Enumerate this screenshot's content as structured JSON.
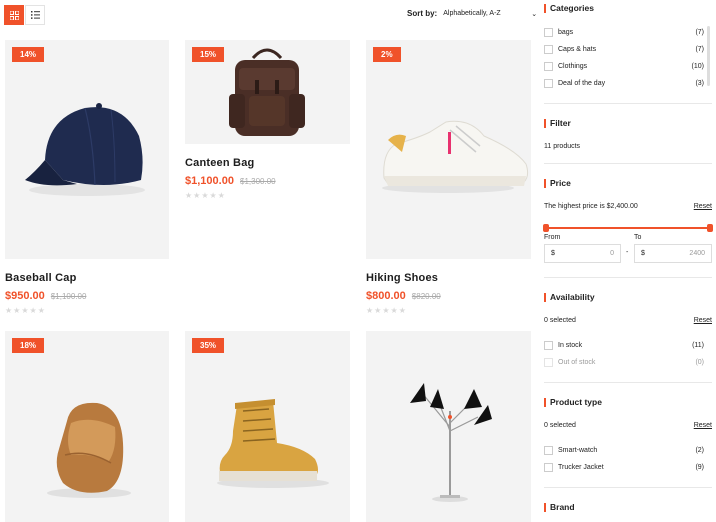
{
  "toolbar": {
    "grid_icon": "grid-icon",
    "list_icon": "list-icon",
    "sort_label": "Sort by:",
    "sort_value": "Alphabetically, A-Z"
  },
  "products": [
    {
      "name": "Baseball Cap",
      "badge": "14%",
      "price": "$950.00",
      "old_price": "$1,100.00",
      "stars": "★★★★★"
    },
    {
      "name": "Canteen Bag",
      "badge": "15%",
      "price": "$1,100.00",
      "old_price": "$1,300.00",
      "stars": "★★★★★"
    },
    {
      "name": "Hiking Shoes",
      "badge": "2%",
      "price": "$800.00",
      "old_price": "$820.00",
      "stars": "★★★★★"
    },
    {
      "name": "",
      "badge": "18%"
    },
    {
      "name": "",
      "badge": "35%"
    },
    {
      "name": "",
      "badge": ""
    }
  ],
  "sidebar": {
    "categories": {
      "title": "Categories",
      "items": [
        {
          "label": "bags",
          "count": "(7)"
        },
        {
          "label": "Caps & hats",
          "count": "(7)"
        },
        {
          "label": "Clothings",
          "count": "(10)"
        },
        {
          "label": "Deal of the day",
          "count": "(3)"
        }
      ]
    },
    "filter": {
      "title": "Filter",
      "summary": "11 products"
    },
    "price": {
      "title": "Price",
      "highest": "The highest price is $2,400.00",
      "reset": "Reset",
      "from_label": "From",
      "to_label": "To",
      "currency": "$",
      "from_placeholder": "0",
      "to_placeholder": "2400",
      "dash": "-"
    },
    "availability": {
      "title": "Availability",
      "selected": "0 selected",
      "reset": "Reset",
      "items": [
        {
          "label": "In stock",
          "count": "(11)"
        },
        {
          "label": "Out of stock",
          "count": "(0)"
        }
      ]
    },
    "product_type": {
      "title": "Product type",
      "selected": "0 selected",
      "reset": "Reset",
      "items": [
        {
          "label": "Smart-watch",
          "count": "(2)"
        },
        {
          "label": "Trucker Jacket",
          "count": "(9)"
        }
      ]
    },
    "brand": {
      "title": "Brand"
    }
  },
  "colors": {
    "accent": "#f0522a",
    "card_bg": "#f3f3f3"
  }
}
